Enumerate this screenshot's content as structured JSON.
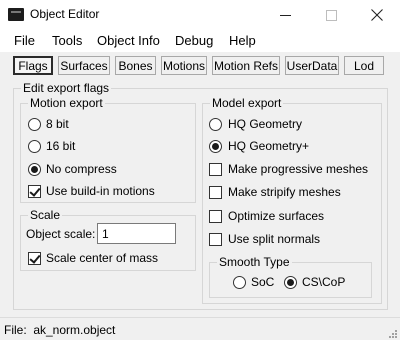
{
  "window": {
    "title": "Object Editor",
    "icon": "app-icon",
    "minimize_icon": "minimize-icon",
    "maximize_icon": "maximize-icon",
    "close_icon": "close-icon"
  },
  "menu": [
    "File",
    "Tools",
    "Object Info",
    "Debug",
    "Help"
  ],
  "tabs": [
    {
      "label": "Flags",
      "active": true
    },
    {
      "label": "Surfaces",
      "active": false
    },
    {
      "label": "Bones",
      "active": false
    },
    {
      "label": "Motions",
      "active": false
    },
    {
      "label": "Motion Refs",
      "active": false
    },
    {
      "label": "UserData",
      "active": false
    },
    {
      "label": "Lod",
      "active": false
    }
  ],
  "edit_export_flags": {
    "title": "Edit export flags",
    "motion_export": {
      "title": "Motion export",
      "options": [
        {
          "label": "8 bit",
          "checked": false
        },
        {
          "label": "16 bit",
          "checked": false
        },
        {
          "label": "No compress",
          "checked": true
        }
      ],
      "use_buildin": {
        "label": "Use build-in motions",
        "checked": true
      }
    },
    "scale": {
      "title": "Scale",
      "object_scale_label": "Object scale:",
      "object_scale_value": "1",
      "scale_center": {
        "label": "Scale center of mass",
        "checked": true
      }
    },
    "model_export": {
      "title": "Model export",
      "radios": [
        {
          "label": "HQ Geometry",
          "checked": false
        },
        {
          "label": "HQ Geometry+",
          "checked": true
        }
      ],
      "checkboxes": [
        {
          "label": "Make progressive meshes",
          "checked": false
        },
        {
          "label": "Make stripify meshes",
          "checked": false
        },
        {
          "label": "Optimize surfaces",
          "checked": false
        },
        {
          "label": "Use split normals",
          "checked": false
        }
      ],
      "smooth_type": {
        "title": "Smooth Type",
        "options": [
          {
            "label": "SoC",
            "checked": false
          },
          {
            "label": "CS\\CoP",
            "checked": true
          }
        ]
      }
    }
  },
  "status": {
    "text": "File:  ak_norm.object"
  }
}
